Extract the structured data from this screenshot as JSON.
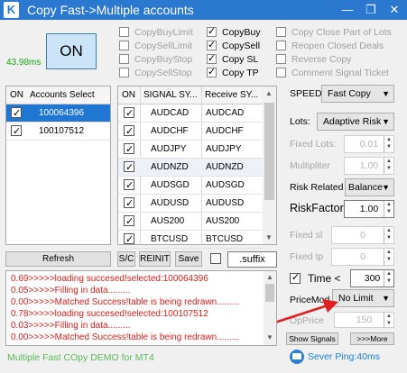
{
  "window": {
    "title": "Copy Fast->Multiple accounts",
    "logo": "K"
  },
  "controls": {
    "minimize": "—",
    "restore": "❐",
    "close": "✕"
  },
  "on_button": "ON",
  "latency": "43.98ms",
  "options": [
    {
      "label": "CopyBuyLimit",
      "checked": false
    },
    {
      "label": "CopySellLimit",
      "checked": false
    },
    {
      "label": "CopyBuyStop",
      "checked": false
    },
    {
      "label": "CopySellStop",
      "checked": false
    },
    {
      "label": "CopyBuy",
      "checked": true
    },
    {
      "label": "CopySell",
      "checked": true
    },
    {
      "label": "Copy SL",
      "checked": true
    },
    {
      "label": "Copy TP",
      "checked": true
    },
    {
      "label": "Copy Close Part of Lots",
      "checked": false
    },
    {
      "label": "Reopen Closed Deals",
      "checked": false
    },
    {
      "label": "Reverse Copy",
      "checked": false
    },
    {
      "label": "Comment Signal Ticket",
      "checked": false
    }
  ],
  "accounts": {
    "header_on": "ON",
    "header_select": "Accounts Select",
    "rows": [
      "100064396",
      "100107512"
    ],
    "refresh_label": "Refresh"
  },
  "symbols": {
    "header_on": "ON",
    "header_signal": "SIGNAL SY...",
    "header_receive": "Receive SY...",
    "rows": [
      {
        "signal": "AUDCAD",
        "receive": "AUDCAD"
      },
      {
        "signal": "AUDCHF",
        "receive": "AUDCHF"
      },
      {
        "signal": "AUDJPY",
        "receive": "AUDJPY"
      },
      {
        "signal": "AUDNZD",
        "receive": "AUDNZD"
      },
      {
        "signal": "AUDSGD",
        "receive": "AUDSGD"
      },
      {
        "signal": "AUDUSD",
        "receive": "AUDUSD"
      },
      {
        "signal": "AUS200",
        "receive": "AUS200"
      },
      {
        "signal": "BTCUSD",
        "receive": "BTCUSD"
      }
    ]
  },
  "buttons": {
    "sc": "S/C",
    "reinit": "REINIT",
    "save": "Save",
    "suffix": ".suffix",
    "show_signals": "Show Signals",
    "more": ">>>More"
  },
  "settings": {
    "speed_label": "SPEED:",
    "speed_value": "Fast Copy",
    "lots_label": "Lots:",
    "lots_value": "Adaptive Risk",
    "fixed_lots_label": "Fixed Lots:",
    "fixed_lots_value": "0.01",
    "multiplier_label": "Multipliter",
    "multiplier_value": "1.00",
    "risk_related_label": "Risk Related",
    "risk_related_value": "Balance",
    "risk_factor_label": "RiskFactor",
    "risk_factor_value": "1.00",
    "fixed_sl_label": "Fixed sl",
    "fixed_sl_value": "0",
    "fixed_tp_label": "Fixed tp",
    "fixed_tp_value": "0",
    "time_label": "Time <",
    "time_value": "300",
    "price_mod_label": "PriceMod",
    "price_mod_value": "No Limit",
    "op_price_label": "OpPrice",
    "op_price_value": "150"
  },
  "log": [
    "0.69>>>>>loading succesed!selected:100064396",
    "0.05>>>>>Filling in data.........",
    "0.00>>>>>Matched Success!table is being redrawn.........",
    "0.78>>>>>loading succesed!selected:100107512",
    "0.03>>>>>Filling in data.........",
    "0.00>>>>>Matched Success!table is being redrawn........."
  ],
  "status": {
    "left": "Multiple Fast COpy DEMO for MT4",
    "ping": "Sever Ping:40ms",
    "left_color": "#5cb85c",
    "ping_color": "#1a7fd4"
  }
}
